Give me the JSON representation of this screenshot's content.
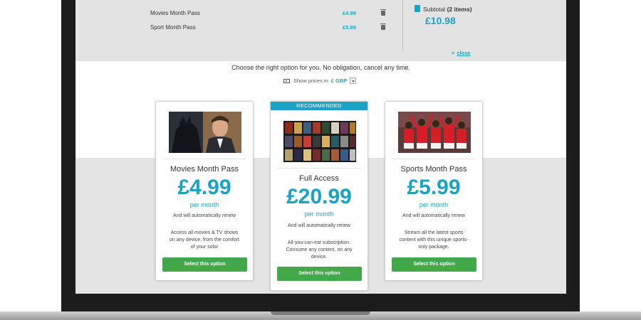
{
  "cart": {
    "items": [
      {
        "name": "Movies Month Pass",
        "price": "£4.99"
      },
      {
        "name": "Sport Month Pass",
        "price": "£5.99"
      }
    ],
    "subtotal_label": "Subtotal",
    "subtotal_count": "(2 items)",
    "subtotal_amount": "£10.98",
    "close_label": "close",
    "close_icon": "×"
  },
  "tagline": "Choose the right option for you. No obligation, cancel any time.",
  "currency": {
    "label": "Show prices in",
    "value": "£ GBP"
  },
  "plans": [
    {
      "title": "Movies Month Pass",
      "price": "£4.99",
      "period": "per month",
      "renew": "And will automatically renew",
      "description": "Access all movies & TV shows on any device, from the comfort of your sofa!",
      "button": "Select this option"
    },
    {
      "badge": "RECOMMENDED",
      "title": "Full Access",
      "price": "£20.99",
      "period": "per month",
      "renew": "And will automatically renew",
      "description": "All-you-can-eat subscription. Consume any content, on any device.",
      "button": "Select this option"
    },
    {
      "title": "Sports Month Pass",
      "price": "£5.99",
      "period": "per month",
      "renew": "And will automatically renew",
      "description": "Stream all the latest sports content with this unique sports-only package.",
      "button": "Select this option"
    }
  ],
  "colors": {
    "accent": "#19a3c5",
    "button": "#43a84a",
    "panel": "#e3e3e3"
  },
  "icons": {
    "bag": "shopping-bag-icon",
    "trash": "trash-icon",
    "cash": "cash-icon",
    "close": "close-icon"
  }
}
